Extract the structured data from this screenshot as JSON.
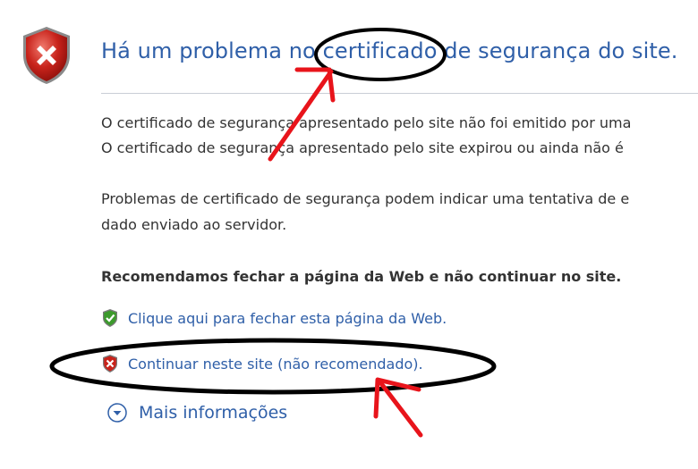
{
  "header": {
    "title": "Há um problema no certificado de segurança do site."
  },
  "content": {
    "line1": "O certificado de segurança apresentado pelo site não foi emitido por uma",
    "line2": "O certificado de segurança apresentado pelo site expirou ou ainda não é",
    "line3": "Problemas de certificado de segurança podem indicar uma tentativa de e",
    "line4": "dado enviado ao servidor.",
    "recommendation": "Recomendamos fechar a página da Web e não continuar no site."
  },
  "actions": {
    "close_page": "Clique aqui para fechar esta página da Web.",
    "continue_site": "Continuar neste site (não recomendado).",
    "more_info": "Mais informações"
  },
  "colors": {
    "link": "#2f5fa8",
    "annotation_red": "#e8141b",
    "annotation_black": "#000000"
  },
  "icons": {
    "header": "shield-error-icon",
    "close": "green-check-shield-icon",
    "continue": "red-x-shield-icon",
    "more": "chevron-down-circle-icon"
  }
}
